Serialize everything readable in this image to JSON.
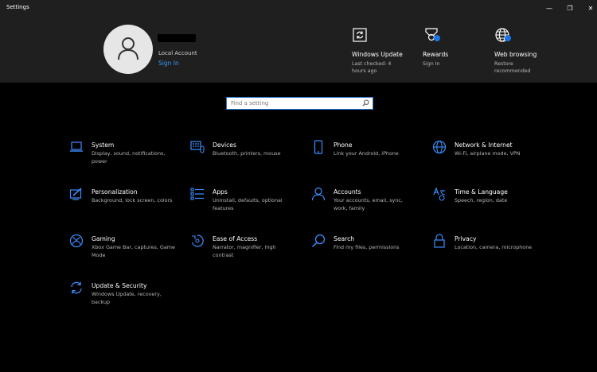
{
  "window": {
    "title": "Settings",
    "minimize": "—",
    "maximize": "❐",
    "close": "✕"
  },
  "account": {
    "type": "Local Account",
    "sign_in": "Sign In"
  },
  "header_cards": [
    {
      "title": "Windows Update",
      "subtitle": "Last checked: 4 hours ago",
      "icon": "windows-update-icon"
    },
    {
      "title": "Rewards",
      "subtitle": "Sign In",
      "icon": "rewards-icon"
    },
    {
      "title": "Web browsing",
      "subtitle": "Restore recommended",
      "icon": "globe-icon"
    }
  ],
  "search": {
    "placeholder": "Find a setting"
  },
  "categories": [
    {
      "title": "System",
      "subtitle": "Display, sound, notifications, power",
      "icon": "laptop-icon"
    },
    {
      "title": "Devices",
      "subtitle": "Bluetooth, printers, mouse",
      "icon": "keyboard-icon"
    },
    {
      "title": "Phone",
      "subtitle": "Link your Android, iPhone",
      "icon": "phone-icon"
    },
    {
      "title": "Network & Internet",
      "subtitle": "Wi-Fi, airplane mode, VPN",
      "icon": "globe-icon"
    },
    {
      "title": "Personalization",
      "subtitle": "Background, lock screen, colors",
      "icon": "paint-icon"
    },
    {
      "title": "Apps",
      "subtitle": "Uninstall, defaults, optional features",
      "icon": "apps-list-icon"
    },
    {
      "title": "Accounts",
      "subtitle": "Your accounts, email, sync, work, family",
      "icon": "person-icon"
    },
    {
      "title": "Time & Language",
      "subtitle": "Speech, region, date",
      "icon": "time-language-icon"
    },
    {
      "title": "Gaming",
      "subtitle": "Xbox Game Bar, captures, Game Mode",
      "icon": "xbox-icon"
    },
    {
      "title": "Ease of Access",
      "subtitle": "Narrator, magnifier, high contrast",
      "icon": "ease-of-access-icon"
    },
    {
      "title": "Search",
      "subtitle": "Find my files, permissions",
      "icon": "search-icon"
    },
    {
      "title": "Privacy",
      "subtitle": "Location, camera, microphone",
      "icon": "lock-icon"
    },
    {
      "title": "Update & Security",
      "subtitle": "Windows Update, recovery, backup",
      "icon": "sync-icon"
    }
  ],
  "colors": {
    "accent": "#1a73e8",
    "icon_blue": "#3b8eff",
    "header_bg": "#1f1f1f",
    "page_bg": "#000000"
  }
}
